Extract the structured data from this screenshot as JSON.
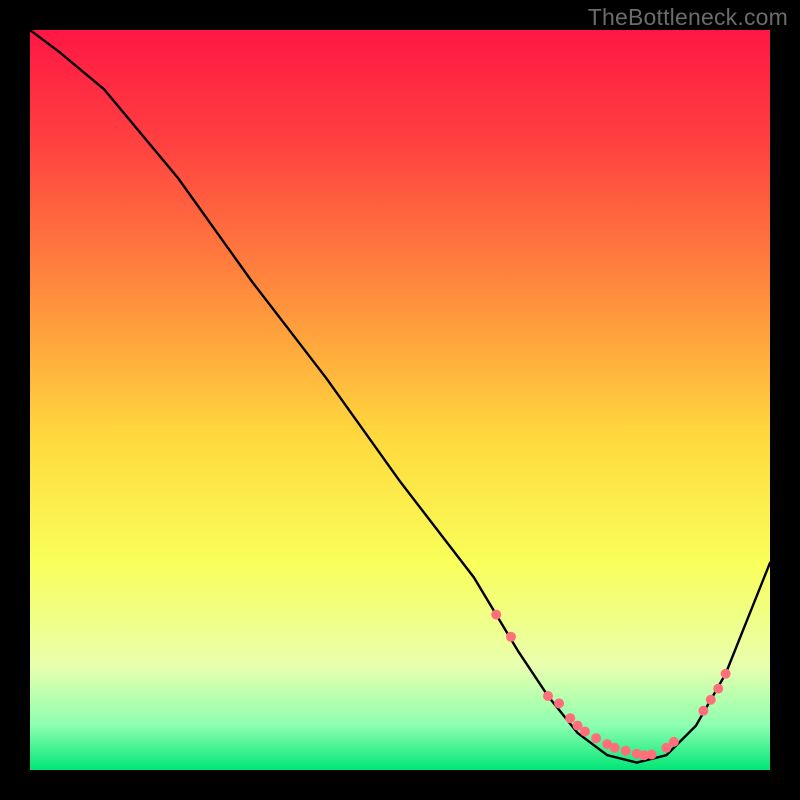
{
  "attribution": "TheBottleneck.com",
  "chart_data": {
    "type": "line",
    "title": "",
    "xlabel": "",
    "ylabel": "",
    "xlim": [
      0,
      100
    ],
    "ylim": [
      0,
      100
    ],
    "grid": false,
    "legend": false,
    "background_gradient_stops": [
      {
        "offset": 0.0,
        "color": "#ff1744"
      },
      {
        "offset": 0.15,
        "color": "#ff4040"
      },
      {
        "offset": 0.35,
        "color": "#ff8a3d"
      },
      {
        "offset": 0.55,
        "color": "#ffd93d"
      },
      {
        "offset": 0.72,
        "color": "#f9ff5a"
      },
      {
        "offset": 0.86,
        "color": "#e8ffae"
      },
      {
        "offset": 0.94,
        "color": "#8cffb0"
      },
      {
        "offset": 1.0,
        "color": "#00e676"
      }
    ],
    "series": [
      {
        "name": "bottleneck-curve",
        "color": "#000000",
        "x": [
          0,
          4,
          10,
          20,
          30,
          40,
          50,
          60,
          66,
          70,
          74,
          78,
          82,
          86,
          90,
          94,
          100
        ],
        "y": [
          100,
          97,
          92,
          80,
          66,
          53,
          39,
          26,
          16,
          10,
          5,
          2,
          1,
          2,
          6,
          13,
          28
        ]
      }
    ],
    "markers": {
      "name": "highlight-dots",
      "color": "#ff6f7a",
      "radius": 5,
      "x": [
        63,
        65,
        70,
        71.5,
        73,
        74,
        75,
        76.5,
        78,
        79,
        80.5,
        82,
        83,
        84,
        86,
        87,
        91,
        92,
        93,
        94
      ],
      "y": [
        21,
        18,
        10,
        9,
        7,
        6,
        5.2,
        4.3,
        3.5,
        3,
        2.6,
        2.2,
        2,
        2.1,
        3,
        3.8,
        8,
        9.5,
        11,
        13
      ]
    }
  }
}
